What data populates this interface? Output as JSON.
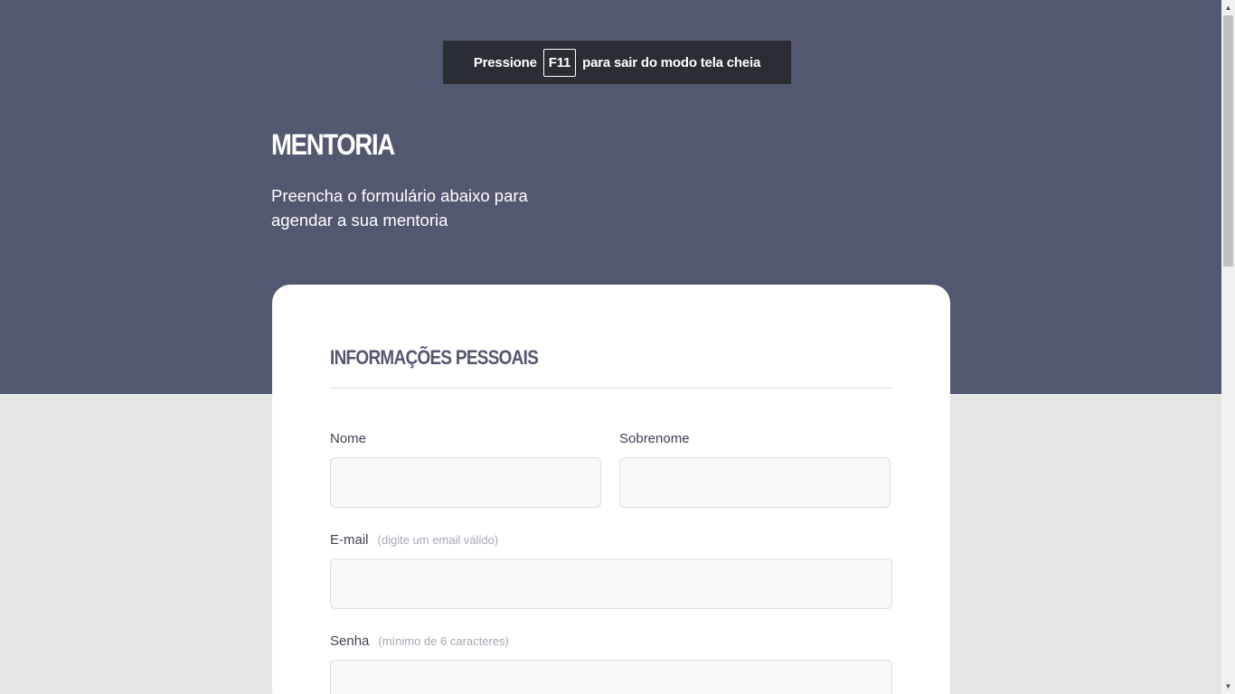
{
  "fullscreen_toast": {
    "before": "Pressione",
    "key": "F11",
    "after": "para sair do modo tela cheia"
  },
  "hero": {
    "brand": "MENTORIA",
    "subtitle": "Preencha o formulário abaixo para agendar a sua mentoria"
  },
  "form": {
    "section_title": "INFORMAÇÕES PESSOAIS",
    "first_name": {
      "label": "Nome",
      "value": ""
    },
    "last_name": {
      "label": "Sobrenome",
      "value": ""
    },
    "email": {
      "label": "E-mail",
      "hint": "(digite um email válido)",
      "value": ""
    },
    "password": {
      "label": "Senha",
      "hint": "(mínimo de 6 caracteres)",
      "value": ""
    }
  },
  "scrollbar": {
    "up_arrow": "▲",
    "down_arrow": "▼"
  },
  "colors": {
    "hero_bg": "#525870",
    "page_bg": "#e5e5e5",
    "card_bg": "#ffffff",
    "title_color": "#525870"
  }
}
